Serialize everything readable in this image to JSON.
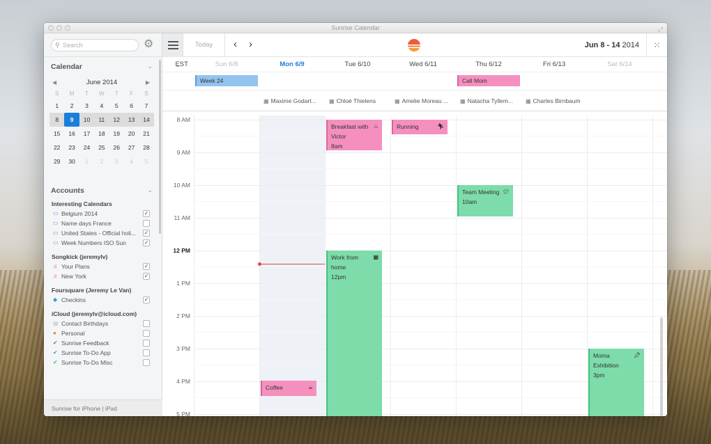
{
  "window": {
    "title": "Sunrise Calendar"
  },
  "sidebar": {
    "search_placeholder": "Search",
    "calendar_section": "Calendar",
    "mini_month": "June 2014",
    "dow": [
      "S",
      "M",
      "T",
      "W",
      "T",
      "F",
      "S"
    ],
    "weeks": [
      [
        "1",
        "2",
        "3",
        "4",
        "5",
        "6",
        "7"
      ],
      [
        "8",
        "9",
        "10",
        "11",
        "12",
        "13",
        "14"
      ],
      [
        "15",
        "16",
        "17",
        "18",
        "19",
        "20",
        "21"
      ],
      [
        "22",
        "23",
        "24",
        "25",
        "26",
        "27",
        "28"
      ],
      [
        "29",
        "30",
        "1",
        "2",
        "3",
        "4",
        "5"
      ]
    ],
    "accounts_section": "Accounts",
    "groups": [
      {
        "name": "Interesting Calendars",
        "items": [
          {
            "label": "Belgium 2014",
            "icon": "calendar-icon",
            "color": "#4a90d9",
            "checked": true
          },
          {
            "label": "Name days France",
            "icon": "calendar-icon",
            "color": "#4a90d9",
            "checked": false
          },
          {
            "label": "United States - Official holi...",
            "icon": "calendar-icon",
            "color": "#4a90d9",
            "checked": true
          },
          {
            "label": "Week Numbers ISO Sun",
            "icon": "calendar-icon",
            "color": "#4a90d9",
            "checked": true
          }
        ]
      },
      {
        "name": "Songkick (jeremylv)",
        "items": [
          {
            "label": "Your Plans",
            "icon": "music-icon",
            "color": "#e0457b",
            "checked": true
          },
          {
            "label": "New York",
            "icon": "music-icon",
            "color": "#e0457b",
            "checked": true
          }
        ]
      },
      {
        "name": "Foursquare (Jeremy Le Van)",
        "items": [
          {
            "label": "Checkins",
            "icon": "foursquare-icon",
            "color": "#2d9fd8",
            "checked": true
          }
        ]
      },
      {
        "name": "iCloud (jeremylv@icloud.com)",
        "items": [
          {
            "label": "Contact Birthdays",
            "icon": "birthday-icon",
            "color": "#bbbbbb",
            "checked": false
          },
          {
            "label": "Personal",
            "icon": "dot-icon",
            "color": "#f07a2a",
            "checked": false
          },
          {
            "label": "Sunrise Feedback",
            "icon": "check-icon",
            "color": "#9b59b6",
            "checked": false
          },
          {
            "label": "Sunrise To-Do App",
            "icon": "check-icon",
            "color": "#2ea0d8",
            "checked": false
          },
          {
            "label": "Sunrise To-Do Misc",
            "icon": "check-icon",
            "color": "#3fbf6a",
            "checked": false
          }
        ]
      }
    ],
    "footer": "Sunrise for iPhone | iPad"
  },
  "toolbar": {
    "today_label": "Today",
    "range_bold": "Jun 8 - 14",
    "range_year": " 2014"
  },
  "days": {
    "timezone": "EST",
    "headers": [
      "Sun 6/8",
      "Mon 6/9",
      "Tue 6/10",
      "Wed 6/11",
      "Thu 6/12",
      "Fri 6/13",
      "Sat 6/14"
    ]
  },
  "allday_events": [
    {
      "title": "Week 24",
      "color": "blue"
    },
    {
      "title": "Call Mom",
      "color": "pink"
    }
  ],
  "people": [
    "Maxime Godart...",
    "Chloé Thielens",
    "Amelie Moreau ...",
    "Natacha Tyllem...",
    "Charles Birnbaum"
  ],
  "hours": [
    "8 AM",
    "9 AM",
    "10 AM",
    "11 AM",
    "12 PM",
    "1 PM",
    "2 PM",
    "3 PM",
    "4 PM",
    "5 PM"
  ],
  "events": [
    {
      "title": "Breakfast with Victor",
      "time": "8am",
      "icon": "coffee-icon",
      "color": "pink"
    },
    {
      "title": "Running",
      "time": "",
      "icon": "runner-icon",
      "color": "pink"
    },
    {
      "title": "Team Meeting",
      "time": "10am",
      "icon": "chat-icon",
      "color": "green"
    },
    {
      "title": "Work from home",
      "time": "12pm",
      "icon": "building-icon",
      "color": "green"
    },
    {
      "title": "Coffee",
      "time": "",
      "icon": "cup-icon",
      "color": "pink"
    },
    {
      "title": "Moma Exhibition",
      "time": "3pm",
      "icon": "pin-icon",
      "color": "green"
    }
  ]
}
